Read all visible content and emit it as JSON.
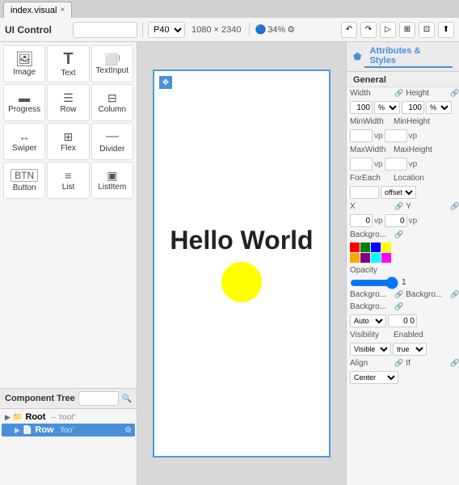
{
  "tab": {
    "label": "index.visual",
    "close": "×"
  },
  "toolbar": {
    "title": "UI Control",
    "search_placeholder": "",
    "device": "P40",
    "dimensions": "1080 × 2340",
    "zoom": "34%"
  },
  "controls": [
    {
      "id": "image",
      "label": "Image",
      "icon": "🖼"
    },
    {
      "id": "text",
      "label": "Text",
      "icon": "T"
    },
    {
      "id": "textinput",
      "label": "TextInput",
      "icon": "⌨"
    },
    {
      "id": "progress",
      "label": "Progress",
      "icon": "▬"
    },
    {
      "id": "row",
      "label": "Row",
      "icon": "☰"
    },
    {
      "id": "column",
      "label": "Column",
      "icon": "▦"
    },
    {
      "id": "swiper",
      "label": "Swiper",
      "icon": "↔"
    },
    {
      "id": "flex",
      "label": "Flex",
      "icon": "⊞"
    },
    {
      "id": "divider",
      "label": "Divider",
      "icon": "—"
    },
    {
      "id": "button",
      "label": "Button",
      "icon": "⬜"
    },
    {
      "id": "list",
      "label": "List",
      "icon": "≡"
    },
    {
      "id": "listitem",
      "label": "ListItem",
      "icon": "▣"
    }
  ],
  "component_tree": {
    "title": "Component Tree",
    "search_placeholder": "",
    "items": [
      {
        "id": "root-item",
        "level": 0,
        "name": "Root",
        "tag": "– 'root'",
        "selected": false,
        "chevron": "▶",
        "indent": false
      },
      {
        "id": "row-item",
        "level": 1,
        "name": "Row",
        "tag": "'foo'",
        "selected": true,
        "chevron": "▶",
        "indent": true
      }
    ]
  },
  "canvas": {
    "hello_world": "Hello World"
  },
  "attrs": {
    "tabs": [
      {
        "label": "Attributes & Styles",
        "active": true
      }
    ],
    "section": "General",
    "width_label": "Width",
    "width_value": "100",
    "width_unit": "%",
    "height_label": "Height",
    "height_value": "100",
    "height_unit": "%",
    "minwidth_label": "MinWidth",
    "minwidth_unit": "vp",
    "minheight_label": "MinHeight",
    "minheight_unit": "vp",
    "maxwidth_label": "MaxWidth",
    "maxwidth_unit": "vp",
    "maxheight_label": "MaxHeight",
    "maxheight_unit": "vp",
    "foreach_label": "ForEach",
    "location_label": "Location",
    "location_value": "offset",
    "x_label": "X",
    "x_value": "0",
    "x_unit": "vp",
    "y_label": "Y",
    "y_value": "0",
    "y_unit": "vp",
    "backgro_label": "Backgro...",
    "opacity_label": "Opacity",
    "opacity_value": "1",
    "backgro2_label": "Backgro...",
    "backgro3_label": "Backgro...",
    "backgro4_label": "Backgro...",
    "backgro4_value": "Auto",
    "backgro5_value": "0 0",
    "visibility_label": "Visibility",
    "visibility_value": "Visible",
    "enabled_label": "Enabled",
    "enabled_value": "true",
    "align_label": "Align",
    "align_if": "If",
    "align_value": "Center"
  }
}
